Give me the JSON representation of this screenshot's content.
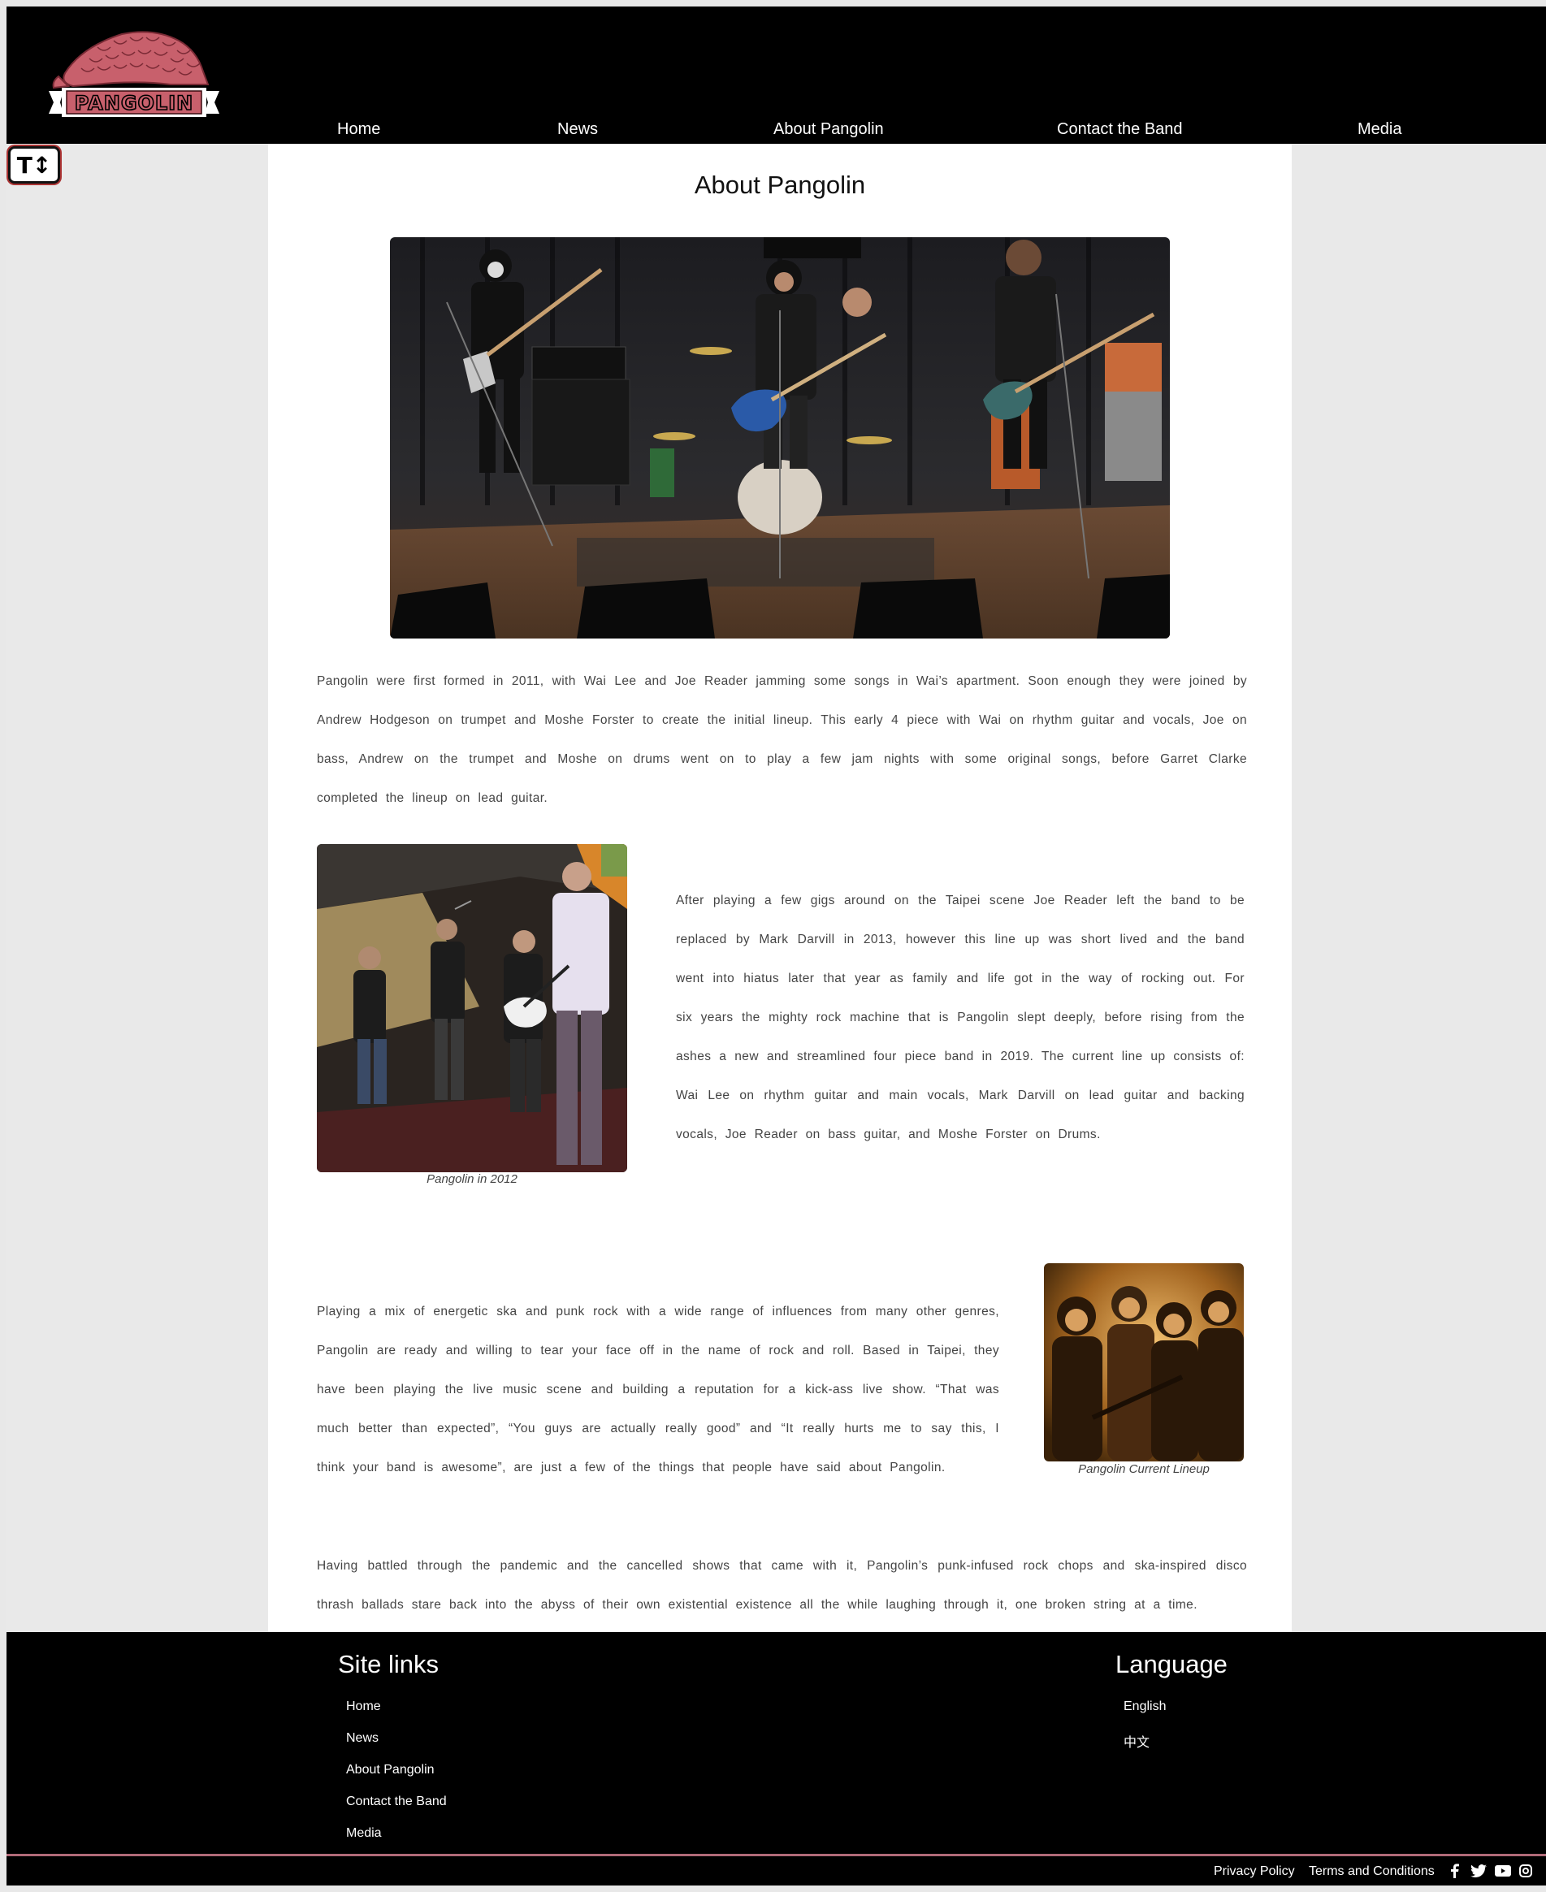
{
  "header": {
    "logo_text": "PANGOLIN",
    "nav": [
      "Home",
      "News",
      "About Pangolin",
      "Contact the Band",
      "Media"
    ],
    "text_size_button": "T↕"
  },
  "main": {
    "title": "About Pangolin",
    "paragraphs": [
      "Pangolin were first formed in 2011, with Wai Lee and Joe Reader jamming some songs in Wai’s apartment. Soon enough they were joined by Andrew Hodgeson on trumpet and Moshe Forster to create the initial lineup. This early 4 piece with Wai on rhythm guitar and vocals, Joe on bass, Andrew on the trumpet and Moshe on drums went on to play a few jam nights with some original songs, before Garret Clarke completed the lineup on lead guitar.",
      "After playing a few gigs around on the Taipei scene Joe Reader left the band to be replaced by Mark Darvill in 2013, however this line up was short lived and the band went into hiatus later that year as family and life got in the way of rocking out. For six years the mighty rock machine that is Pangolin slept deeply, before rising from the ashes a new and streamlined four piece band in 2019. The current line up consists of: Wai Lee on rhythm guitar and main vocals, Mark Darvill on lead guitar and backing vocals, Joe Reader on bass guitar, and Moshe Forster on Drums.",
      "Playing a mix of energetic ska and punk rock with a wide range of influences from many other genres, Pangolin are ready and willing to tear your face off in the name of rock and roll. Based in Taipei, they have been playing the live music scene and building a reputation for a kick-ass live show. “That was much better than expected”, “You guys are actually really good” and “It really hurts me to say this, I think your band is awesome”, are just a few of the things that people have said about Pangolin.",
      "Having battled through the pandemic and the cancelled shows that came with it, Pangolin’s punk-infused rock chops and ska-inspired disco thrash ballads stare back into the abyss of their own existential existence all the while laughing through it, one broken string at a time."
    ],
    "captions": [
      "Pangolin in 2012",
      "Pangolin Current Lineup"
    ]
  },
  "footer": {
    "site_links_heading": "Site links",
    "site_links": [
      "Home",
      "News",
      "About Pangolin",
      "Contact the Band",
      "Media"
    ],
    "language_heading": "Language",
    "languages": [
      "English",
      "中文"
    ],
    "bottom_links": [
      "Privacy Policy",
      "Terms and Conditions"
    ],
    "social_icons": [
      "facebook-icon",
      "twitter-icon",
      "youtube-icon",
      "instagram-icon"
    ]
  },
  "colors": {
    "header_bg": "#000000",
    "logo_red": "#c8606c",
    "divider": "#b06a78"
  }
}
